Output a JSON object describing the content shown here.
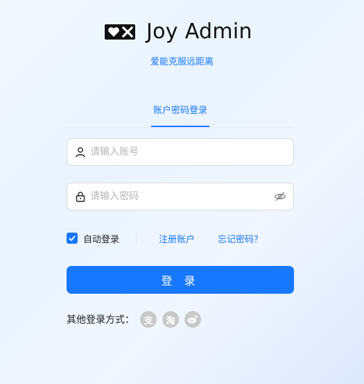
{
  "app": {
    "title": "Joy Admin",
    "slogan": "爱能克服远距离"
  },
  "tabs": [
    {
      "label": "账户密码登录",
      "active": true
    }
  ],
  "form": {
    "account_placeholder": "请输入账号",
    "account_value": "",
    "password_placeholder": "请输入密码",
    "password_value": "",
    "remember_label": "自动登录",
    "remember_checked": true,
    "register_label": "注册账户",
    "forgot_label": "忘记密码？",
    "login_label": "登 录"
  },
  "other_login": {
    "label": "其他登录方式：",
    "providers": [
      {
        "glyph": "支",
        "icon": "alipay-icon"
      },
      {
        "glyph": "淘",
        "icon": "taobao-icon"
      },
      {
        "glyph": "",
        "icon": "weibo-icon"
      }
    ]
  },
  "colors": {
    "accent": "#1677ff",
    "social_gray": "#c9c9c9"
  }
}
